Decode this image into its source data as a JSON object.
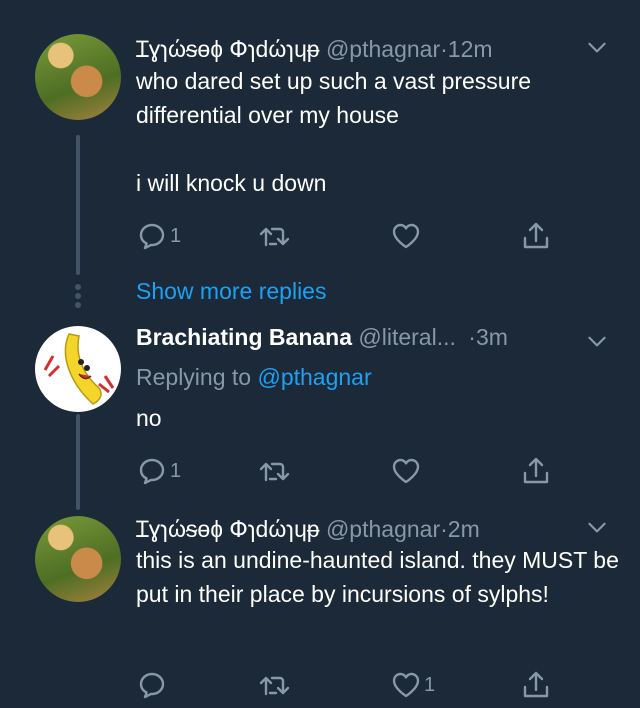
{
  "tweets": [
    {
      "name": "Ɪɣɿώᵴɵɸ Փɿdώɿɥᵽ",
      "handle": "@pthagnar",
      "dot": "·",
      "time": "12m",
      "text": "who dared set up such a vast pressure differential over my house\n\ni will knock u down",
      "reply_count": "1",
      "retweet_count": "",
      "like_count": ""
    },
    {
      "name": "Brachiating Banana",
      "handle": "@literal...",
      "dot": "·",
      "time": "3m",
      "replying_prefix": "Replying to",
      "replying_to": "@pthagnar",
      "text": "no",
      "reply_count": "1",
      "retweet_count": "",
      "like_count": ""
    },
    {
      "name": "Ɪɣɿώᵴɵɸ Փɿdώɿɥᵽ",
      "handle": "@pthagnar",
      "dot": "·",
      "time": "2m",
      "text": "this is an undine-haunted island. they MUST be put in their place by incursions of sylphs!",
      "reply_count": "",
      "retweet_count": "",
      "like_count": "1"
    }
  ],
  "show_more": "Show more replies",
  "icons": {
    "reply": "reply-icon",
    "retweet": "retweet-icon",
    "like": "heart-icon",
    "share": "share-icon",
    "caret": "chevron-down-icon"
  },
  "colors": {
    "background": "#1c2938",
    "secondary_text": "#8899a6",
    "link": "#1da1f2",
    "thread_line": "#425466"
  }
}
